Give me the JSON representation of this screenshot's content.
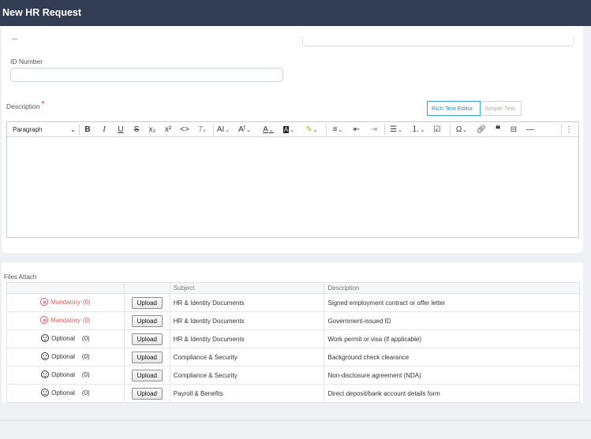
{
  "header": {
    "title": "New HR Request"
  },
  "form": {
    "id_label": "ID Number",
    "id_value": "",
    "description_label": "Description",
    "required_mark": "*",
    "editor_modes": [
      "Rich Text Editor",
      "Simple Text"
    ],
    "active_mode": "Rich Text Editor",
    "paragraph_select": "Paragraph",
    "content": ""
  },
  "toolbar_icons": [
    "bold-icon",
    "italic-icon",
    "underline-icon",
    "strikethrough-icon",
    "subscript-icon",
    "superscript-icon",
    "code-icon",
    "clear-format-icon",
    "font-size-icon",
    "font-family-icon",
    "font-color-icon",
    "highlight-icon",
    "marker-icon",
    "align-icon",
    "outdent-icon",
    "indent-icon",
    "bulleted-list-icon",
    "numbered-list-icon",
    "todo-list-icon",
    "special-characters-icon",
    "link-icon",
    "blockquote-icon",
    "page-break-icon",
    "horizontal-line-icon",
    "more-icon"
  ],
  "files": {
    "label": "Files Attach",
    "columns": [
      "",
      "",
      "Subject",
      "Description"
    ],
    "rows": [
      {
        "status": "Mandatory",
        "count": "(0)",
        "upload": "Upload",
        "subject": "HR & Identity Documents",
        "description": "Signed employment contract or offer letter"
      },
      {
        "status": "Mandatory",
        "count": "(0)",
        "upload": "Upload",
        "subject": "HR & Identity Documents",
        "description": "Government-issued ID"
      },
      {
        "status": "Optional",
        "count": "(0)",
        "upload": "Upload",
        "subject": "HR & Identity Documents",
        "description": "Work permit or visa (if applicable)"
      },
      {
        "status": "Optional",
        "count": "(0)",
        "upload": "Upload",
        "subject": "Compliance & Security",
        "description": "Background check clearance"
      },
      {
        "status": "Optional",
        "count": "(0)",
        "upload": "Upload",
        "subject": "Compliance & Security",
        "description": "Non-disclosure agreement (NDA)"
      },
      {
        "status": "Optional",
        "count": "(0)",
        "upload": "Upload",
        "subject": "Payroll & Benefits",
        "description": "Direct deposit/bank account details form"
      }
    ]
  },
  "colors": {
    "header": "#323c52",
    "mandatory": "#e35d5d",
    "accent": "#39a2c3"
  }
}
